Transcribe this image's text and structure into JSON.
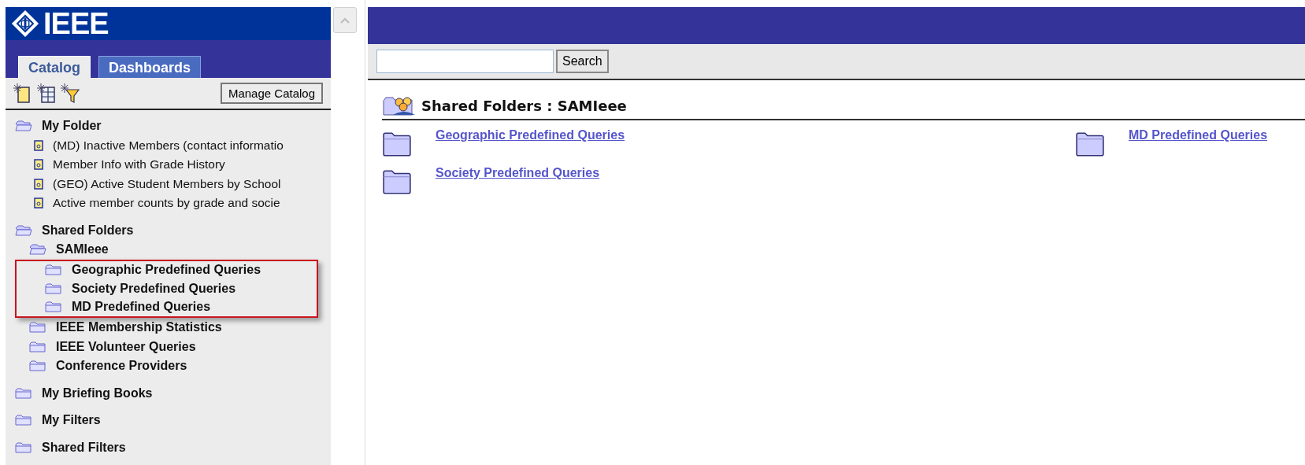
{
  "logo": {
    "text": "IEEE"
  },
  "tabs": [
    {
      "label": "Catalog",
      "selected": true
    },
    {
      "label": "Dashboards",
      "selected": false
    }
  ],
  "toolbar": {
    "manage_button": "Manage Catalog"
  },
  "tree": [
    {
      "label": "My Folder",
      "kind": "folder",
      "expanded": true,
      "children": [
        {
          "label": "(MD) Inactive Members (contact informatio",
          "kind": "report"
        },
        {
          "label": "Member Info with Grade History",
          "kind": "report"
        },
        {
          "label": "(GEO) Active Student Members by School",
          "kind": "report"
        },
        {
          "label": "Active member counts by grade and socie",
          "kind": "report"
        }
      ]
    },
    {
      "label": "Shared Folders",
      "kind": "folder",
      "expanded": true,
      "children": [
        {
          "label": "SAMIeee",
          "kind": "folder",
          "expanded": true,
          "children_highlighted": true,
          "children": [
            {
              "label": "Geographic Predefined Queries",
              "kind": "folder",
              "expanded": false
            },
            {
              "label": "Society Predefined Queries",
              "kind": "folder",
              "expanded": false
            },
            {
              "label": "MD Predefined Queries",
              "kind": "folder",
              "expanded": false
            }
          ]
        },
        {
          "label": "IEEE Membership Statistics",
          "kind": "folder",
          "expanded": false
        },
        {
          "label": "IEEE Volunteer Queries",
          "kind": "folder",
          "expanded": false
        },
        {
          "label": "Conference Providers",
          "kind": "folder",
          "expanded": false
        }
      ]
    },
    {
      "label": "My Briefing Books",
      "kind": "folder",
      "expanded": false
    },
    {
      "label": "My Filters",
      "kind": "folder",
      "expanded": false
    },
    {
      "label": "Shared Filters",
      "kind": "folder",
      "expanded": false
    }
  ],
  "search": {
    "button": "Search"
  },
  "breadcrumb": "Shared Folders : SAMIeee",
  "folders": [
    {
      "label": "Geographic Predefined Queries"
    },
    {
      "label": "MD Predefined Queries"
    },
    {
      "label": "Society Predefined Queries"
    }
  ]
}
